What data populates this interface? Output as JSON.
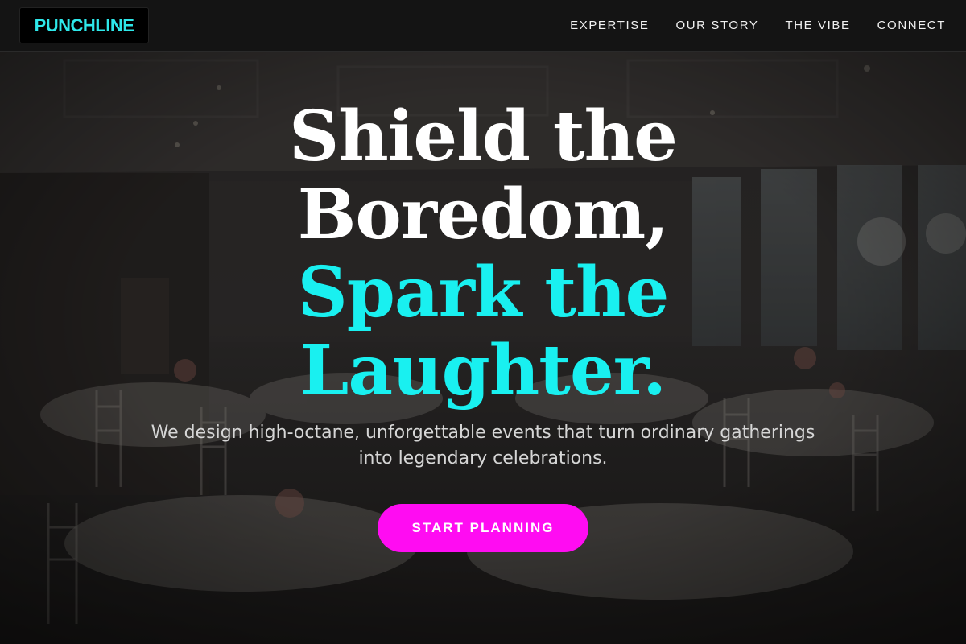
{
  "brand": {
    "logo_text": "PUNCHLINE"
  },
  "nav": {
    "items": [
      {
        "label": "EXPERTISE"
      },
      {
        "label": "OUR STORY"
      },
      {
        "label": "THE VIBE"
      },
      {
        "label": "CONNECT"
      }
    ]
  },
  "hero": {
    "headline_lines": [
      "Shield the",
      "Boredom,",
      "Spark the",
      "Laughter."
    ],
    "subtitle": "We design high-octane, unforgettable events that turn ordinary gatherings into legendary celebrations.",
    "cta_label": "START PLANNING"
  },
  "colors": {
    "accent_cyan": "#19f0f0",
    "cta_magenta": "#ff0cf2",
    "header_bg": "#141414"
  }
}
